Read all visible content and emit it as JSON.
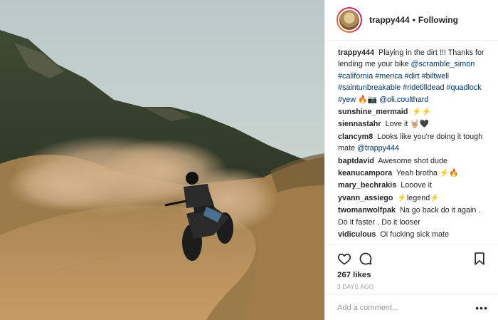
{
  "post": {
    "username": "trappy444",
    "follow_status": "Following",
    "separator": "•"
  },
  "caption": {
    "user": "trappy444",
    "text": "Playing in the dirt !!! Thanks for lending me your bike",
    "tags": "@scramble_simon #california #merica #dirt #biltwell #saintunbreakable #ridetilldead #quadlock #yew 🔥📷 @oli.coulthard"
  },
  "comments": [
    {
      "user": "sunshine_mermaid",
      "text": "⚡⚡"
    },
    {
      "user": "siennastahr",
      "text": "Love it 🤘🏼🖤"
    },
    {
      "user": "clancym8",
      "text": "Looks like you're doing it tough mate",
      "mention": "@trappy444"
    },
    {
      "user": "baptdavid",
      "text": "Awesome shot dude"
    },
    {
      "user": "keanucampora",
      "text": "Yeah brotha ⚡🔥"
    },
    {
      "user": "mary_bechrakis",
      "text": "Looove it"
    },
    {
      "user": "yvann_assiego",
      "text": "⚡legend⚡"
    },
    {
      "user": "twomanwolfpak",
      "text": "Na go back do it again . Do it faster . Do it looser"
    },
    {
      "user": "vidiculous",
      "text": "Oi fucking sick mate"
    }
  ],
  "actions": {
    "likes": "267 likes",
    "date": "3 DAYS AGO",
    "icons": [
      "heart-icon",
      "comment-icon",
      "bookmark-icon"
    ]
  },
  "add_comment": {
    "placeholder": "Add a comment...",
    "more_label": "•••"
  },
  "colors": {
    "text": "#262626",
    "muted": "#999999",
    "mention": "#003569",
    "divider": "#efefef"
  }
}
